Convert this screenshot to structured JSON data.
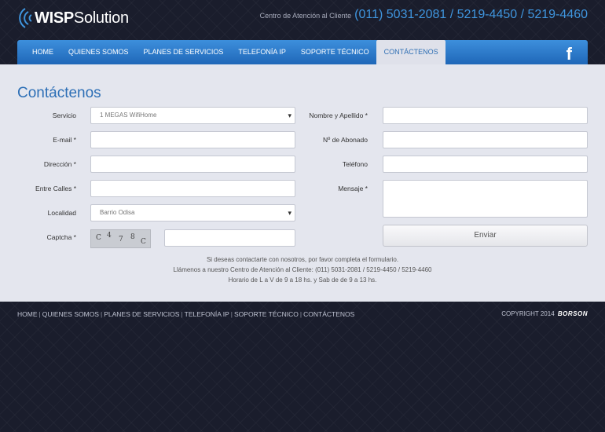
{
  "header": {
    "logo": {
      "bold": "WISP",
      "rest": "Solution"
    },
    "contact_label": "Centro de Atención al Cliente",
    "contact_phones": "(011) 5031-2081 / 5219-4450 / 5219-4460"
  },
  "nav": {
    "items": [
      {
        "label": "HOME"
      },
      {
        "label": "QUIENES SOMOS"
      },
      {
        "label": "PLANES DE SERVICIOS"
      },
      {
        "label": "TELEFONÍA IP"
      },
      {
        "label": "SOPORTE TÉCNICO"
      },
      {
        "label": "CONTÁCTENOS",
        "active": true
      }
    ],
    "social_icon": "facebook-icon",
    "social_glyph": "f"
  },
  "page": {
    "title": "Contáctenos"
  },
  "form": {
    "servicio": {
      "label": "Servicio",
      "value": "1 MEGAS WifiHome"
    },
    "email": {
      "label": "E-mail *",
      "value": ""
    },
    "direccion": {
      "label": "Dirección *",
      "value": ""
    },
    "entre_calles": {
      "label": "Entre Calles *",
      "value": ""
    },
    "localidad": {
      "label": "Localidad",
      "value": "Barrio Odisa"
    },
    "captcha": {
      "label": "Captcha *",
      "value": "",
      "image_text": [
        "C",
        "4",
        "7",
        "8",
        "C"
      ]
    },
    "nombre": {
      "label": "Nombre y Apellido *",
      "value": ""
    },
    "abonado": {
      "label": "Nº de Abonado",
      "value": ""
    },
    "telefono": {
      "label": "Teléfono",
      "value": ""
    },
    "mensaje": {
      "label": "Mensaje *",
      "value": ""
    },
    "submit_label": "Enviar"
  },
  "info": {
    "line1": "Si deseas contactarte con nosotros, por favor completa el formulario.",
    "line2": "Llámenos a nuestro Centro de Atención al Cliente: (011) 5031-2081 / 5219-4450 / 5219-4460",
    "line3": "Horario de L a V de 9 a 18 hs. y Sab de de 9 a 13 hs."
  },
  "footer": {
    "links": [
      "HOME",
      "QUIENES SOMOS",
      "PLANES DE SERVICIOS",
      "TELEFONÍA IP",
      "SOPORTE TÉCNICO",
      "CONTÁCTENOS"
    ],
    "copyright": "COPYRIGHT 2014",
    "brand": "BORSON"
  },
  "colors": {
    "accent": "#3f95de",
    "nav_top": "#3d8fdc",
    "nav_bottom": "#1f67b8",
    "content_bg": "#e4e6ee",
    "page_bg": "#1a1d2c"
  }
}
